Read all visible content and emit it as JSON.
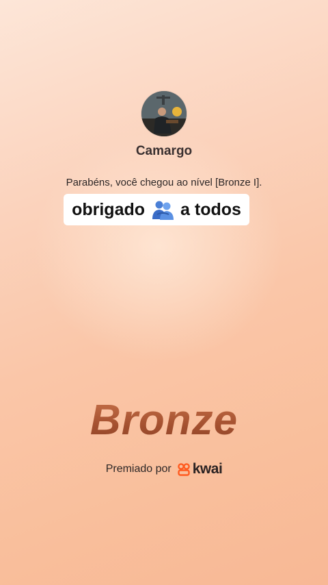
{
  "profile": {
    "username": "Camargo"
  },
  "message": {
    "congrats": "Parabéns, você chegou ao nível [Bronze I].",
    "caption_before": "obrigado",
    "caption_emoji": "people-hugging-icon",
    "caption_after": "a todos"
  },
  "level": {
    "name": "Bronze"
  },
  "footer": {
    "awarded_by": "Premiado por",
    "brand": "kwai"
  },
  "colors": {
    "bronze": "#b0603c",
    "kwai_brand": "#ff5a1f",
    "caption_bg": "#ffffff"
  }
}
